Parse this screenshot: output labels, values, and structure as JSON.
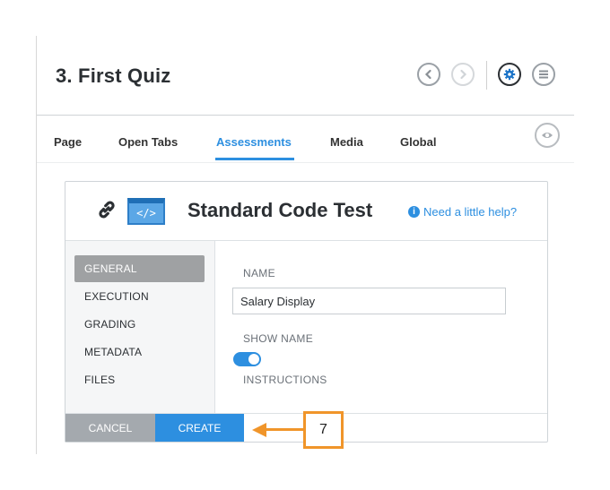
{
  "header": {
    "title": "3. First Quiz",
    "buttons": {
      "prev_icon": "chevron-left-icon",
      "next_icon": "chevron-right-icon",
      "settings_icon": "gear-icon",
      "menu_icon": "hamburger-menu-icon"
    }
  },
  "tabs": [
    {
      "label": "Page",
      "active": false
    },
    {
      "label": "Open Tabs",
      "active": false
    },
    {
      "label": "Assessments",
      "active": true
    },
    {
      "label": "Media",
      "active": false
    },
    {
      "label": "Global",
      "active": false
    }
  ],
  "preview_icon": "eye-icon",
  "panel": {
    "link_icon": "link-icon",
    "code_icon_text": "</>",
    "title": "Standard Code Test",
    "help_label": "Need a little help?",
    "sidebar": [
      {
        "label": "GENERAL",
        "active": true
      },
      {
        "label": "EXECUTION",
        "active": false
      },
      {
        "label": "GRADING",
        "active": false
      },
      {
        "label": "METADATA",
        "active": false
      },
      {
        "label": "FILES",
        "active": false
      }
    ],
    "form": {
      "name_label": "NAME",
      "name_value": "Salary Display",
      "show_name_label": "SHOW NAME",
      "show_name_on": true,
      "instructions_label": "INSTRUCTIONS"
    },
    "footer": {
      "cancel_label": "CANCEL",
      "create_label": "CREATE"
    }
  },
  "annotation": {
    "callout_number": "7",
    "color": "#f0952a"
  },
  "colors": {
    "accent": "#2d8fe0",
    "sidebar_active": "#9fa1a3",
    "cancel_bg": "#a4a9ae"
  }
}
